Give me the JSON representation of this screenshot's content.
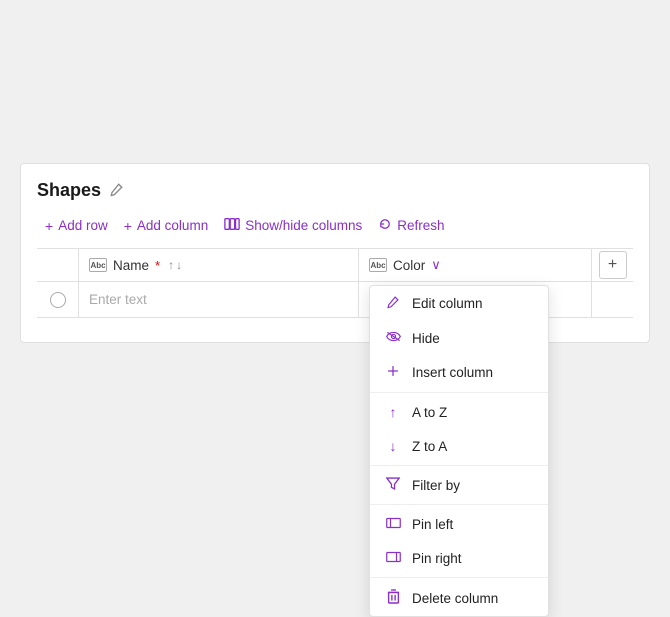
{
  "panel": {
    "title": "Shapes",
    "edit_icon": "✏"
  },
  "toolbar": {
    "add_row": "Add row",
    "add_column": "Add column",
    "show_hide_columns": "Show/hide columns",
    "refresh": "Refresh"
  },
  "columns": {
    "name_label": "Name",
    "color_label": "Color",
    "add_icon": "+"
  },
  "row": {
    "placeholder": "Enter text"
  },
  "dropdown": {
    "items": [
      {
        "key": "edit_column",
        "label": "Edit column",
        "icon": "pencil"
      },
      {
        "key": "hide",
        "label": "Hide",
        "icon": "eye-off"
      },
      {
        "key": "insert_column",
        "label": "Insert column",
        "icon": "plus"
      },
      {
        "key": "a_to_z",
        "label": "A to Z",
        "icon": "arrow-up"
      },
      {
        "key": "z_to_a",
        "label": "Z to A",
        "icon": "arrow-down"
      },
      {
        "key": "filter_by",
        "label": "Filter by",
        "icon": "filter"
      },
      {
        "key": "pin_left",
        "label": "Pin left",
        "icon": "pin-left"
      },
      {
        "key": "pin_right",
        "label": "Pin right",
        "icon": "pin-right"
      },
      {
        "key": "delete_column",
        "label": "Delete column",
        "icon": "trash"
      }
    ]
  }
}
